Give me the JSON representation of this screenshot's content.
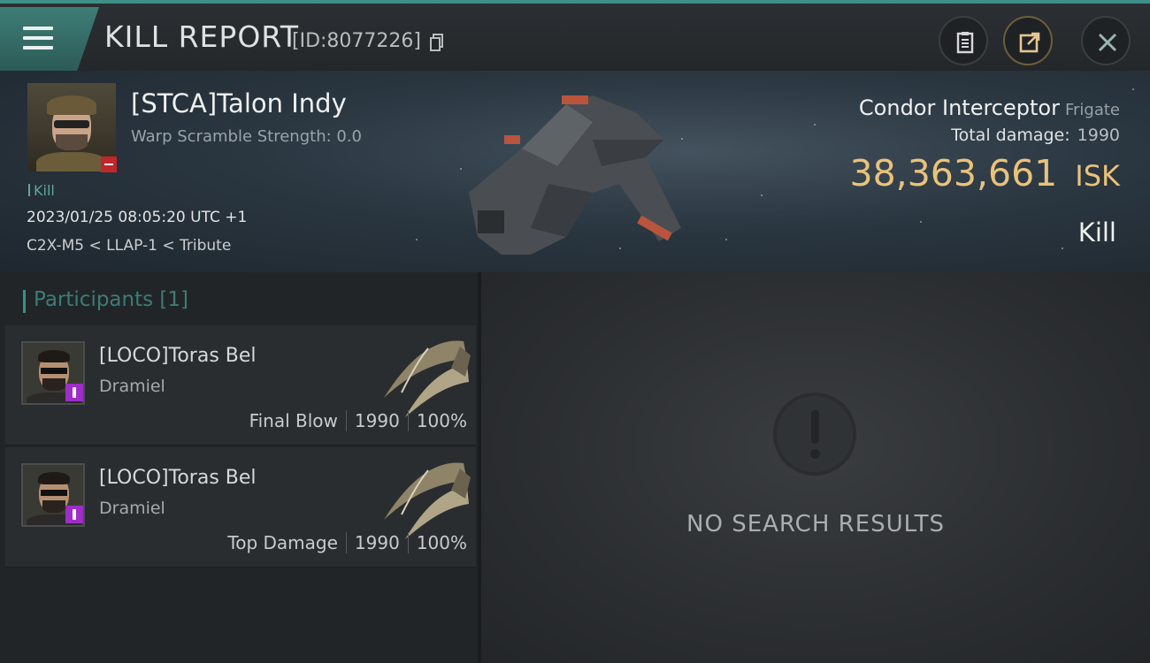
{
  "header": {
    "title": "KILL REPORT",
    "report_id": "[ID:8077226]",
    "accent": "#3e8f86"
  },
  "victim": {
    "name": "[STCA]Talon Indy",
    "warp_scramble": "Warp Scramble Strength: 0.0",
    "kill_tag": "Kill",
    "timestamp": "2023/01/25 08:05:20 UTC +1",
    "location": "C2X-M5 < LLAP-1 < Tribute",
    "ship_name": "Condor Interceptor",
    "ship_class": "Frigate",
    "total_damage_label": "Total damage:",
    "total_damage": "1990",
    "isk_value": "38,363,661",
    "isk_unit": "ISK",
    "result": "Kill",
    "isk_color": "#e9c27a"
  },
  "participants": {
    "header": "Participants [1]",
    "rows": [
      {
        "name": "[LOCO]Toras Bel",
        "ship": "Dramiel",
        "role": "Final Blow",
        "damage": "1990",
        "percent": "100%"
      },
      {
        "name": "[LOCO]Toras Bel",
        "ship": "Dramiel",
        "role": "Top Damage",
        "damage": "1990",
        "percent": "100%"
      }
    ]
  },
  "results": {
    "empty_text": "NO SEARCH RESULTS"
  }
}
